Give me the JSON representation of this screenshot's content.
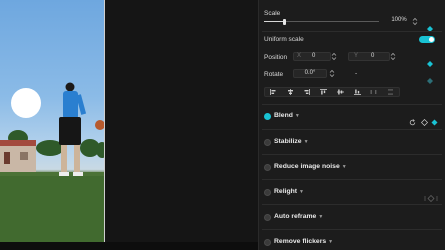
{
  "scale": {
    "label": "Scale",
    "value": "100%",
    "slider_fraction": 0.18
  },
  "uniform_scale": {
    "label": "Uniform scale",
    "enabled": true
  },
  "position": {
    "label": "Position",
    "x_label": "X",
    "x_value": "0",
    "y_label": "Y",
    "y_value": "0"
  },
  "rotate": {
    "label": "Rotate",
    "value": "0.0°",
    "extra": "-"
  },
  "sections": [
    {
      "label": "Blend",
      "enabled": true,
      "has_reset": true
    },
    {
      "label": "Stabilize",
      "enabled": false
    },
    {
      "label": "Reduce image noise",
      "enabled": false
    },
    {
      "label": "Relight",
      "enabled": false
    },
    {
      "label": "Auto reframe",
      "enabled": false
    },
    {
      "label": "Remove flickers",
      "enabled": false
    }
  ],
  "colors": {
    "accent": "#19c2d3",
    "panel_bg": "#1c1c1c",
    "app_bg": "#131313"
  },
  "icons": [
    "diamond-keyframe-icon",
    "reset-icon",
    "stepper-icon",
    "align-left-icon",
    "align-center-icon",
    "align-right-icon",
    "align-top-icon",
    "align-middle-icon",
    "align-bottom-icon"
  ]
}
